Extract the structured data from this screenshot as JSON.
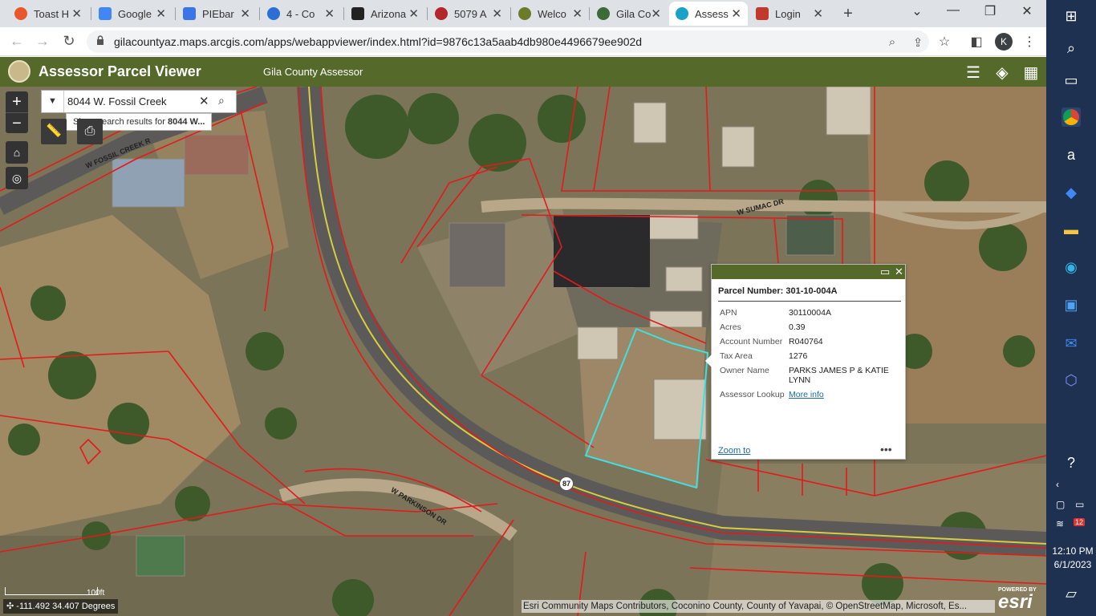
{
  "browser": {
    "tabs": [
      {
        "title": "Toast H",
        "icon": "toast-icon",
        "color": "#e8572c"
      },
      {
        "title": "Google",
        "icon": "google-calendar-icon",
        "color": "#4285f4"
      },
      {
        "title": "PIEbar",
        "icon": "google-docs-icon",
        "color": "#3b73e8"
      },
      {
        "title": "4 - Co",
        "icon": "link-icon",
        "color": "#2b6fd6"
      },
      {
        "title": "Arizona",
        "icon": "arizona-icon",
        "color": "#222222"
      },
      {
        "title": "5079 A",
        "icon": "ring-icon",
        "color": "#b3262b"
      },
      {
        "title": "Welco",
        "icon": "county-seal-icon",
        "color": "#6b7b2a"
      },
      {
        "title": "Gila Co",
        "icon": "globe-icon",
        "color": "#3c6b38"
      },
      {
        "title": "Assess",
        "icon": "arcgis-icon",
        "color": "#1aa1c7"
      },
      {
        "title": "Login",
        "icon": "login-icon",
        "color": "#c0392b"
      }
    ],
    "url": "gilacountyaz.maps.arcgis.com/apps/webappviewer/index.html?id=9876c13a5aab4db980e4496679ee902d",
    "profile_initial": "K"
  },
  "app": {
    "title": "Assessor Parcel Viewer",
    "subtitle": "Gila County Assessor",
    "header_color": "#55692a"
  },
  "search": {
    "value": "8044 W. Fossil Creek",
    "suggestion_prefix": "Show search results for ",
    "suggestion_bold": "8044 W..."
  },
  "map": {
    "street_labels": [
      "W FOSSIL CREEK R",
      "W SUMAC DR",
      "W PARKINSON DR"
    ],
    "route_shield": "87",
    "coordinates": "-111.492 34.407 Degrees",
    "scale": "100ft",
    "attribution": "Esri Community Maps Contributors, Coconino County, County of Yavapai, © OpenStreetMap, Microsoft, Es...",
    "esri_powered": "POWERED BY",
    "esri_name": "esri",
    "parcel_color": "#e31a1c",
    "selected_color": "#3ee0e0"
  },
  "popup": {
    "title": "Parcel Number: 301-10-004A",
    "fields": [
      {
        "label": "APN",
        "value": "30110004A"
      },
      {
        "label": "Acres",
        "value": "0.39"
      },
      {
        "label": "Account Number",
        "value": "R040764"
      },
      {
        "label": "Tax Area",
        "value": "1276"
      },
      {
        "label": "Owner Name",
        "value": "PARKS JAMES P & KATIE LYNN"
      },
      {
        "label": "Assessor Lookup",
        "value": "More info"
      }
    ],
    "zoom_to": "Zoom to"
  },
  "taskbar": {
    "time": "12:10 PM",
    "date": "6/1/2023",
    "badge": "12"
  }
}
